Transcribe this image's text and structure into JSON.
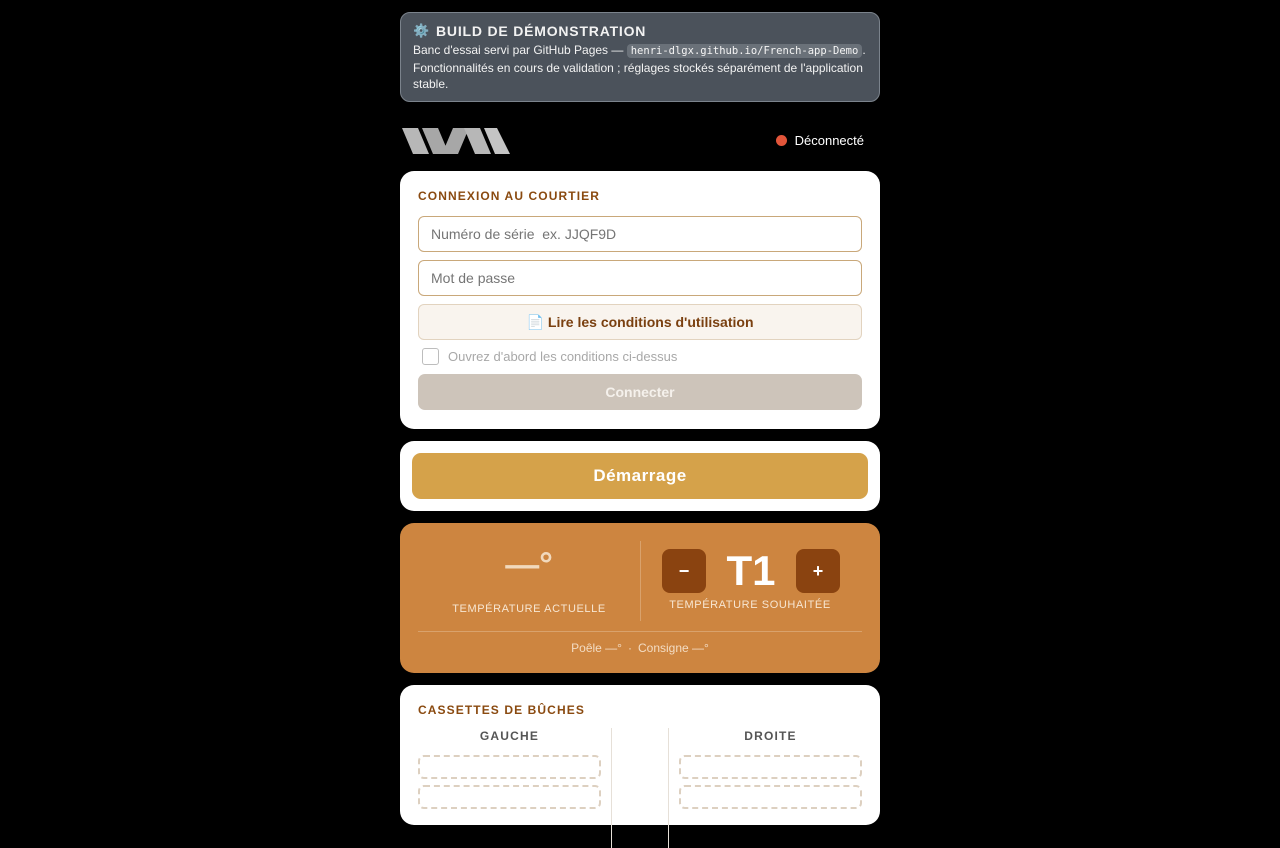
{
  "banner": {
    "icon": "gear-icon",
    "title": "BUILD DE DÉMONSTRATION",
    "line1_prefix": "Banc d'essai servi par GitHub Pages — ",
    "url": "henri-dlgx.github.io/French-app-Demo",
    "line1_suffix": ".",
    "line2": "Fonctionnalités en cours de validation ; réglages stockés séparément de l'application stable."
  },
  "status": {
    "label": "Déconnecté",
    "color": "#e2553a"
  },
  "login": {
    "title": "CONNEXION AU COURTIER",
    "serial_placeholder": "Numéro de série  ex. JJQF9D",
    "password_placeholder": "Mot de passe",
    "terms_icon": "document-icon",
    "terms_label": "Lire les conditions d'utilisation",
    "checkbox_label": "Ouvrez d'abord les conditions ci-dessus",
    "connect_label": "Connecter"
  },
  "start": {
    "label": "Démarrage"
  },
  "temperature": {
    "current_value": "—°",
    "current_label": "TEMPÉRATURE ACTUELLE",
    "minus_label": "−",
    "setpoint": "T1",
    "plus_label": "+",
    "target_label": "TEMPÉRATURE SOUHAITÉE",
    "stove_label": "Poêle —°",
    "separator": "·",
    "setpoint_label": "Consigne —°"
  },
  "cassettes": {
    "title": "CASSETTES DE BÛCHES",
    "left_label": "GAUCHE",
    "right_label": "DROITE"
  },
  "colors": {
    "accent": "#d5a24a",
    "temp_card": "#cd8540",
    "brown": "#8a4310"
  }
}
